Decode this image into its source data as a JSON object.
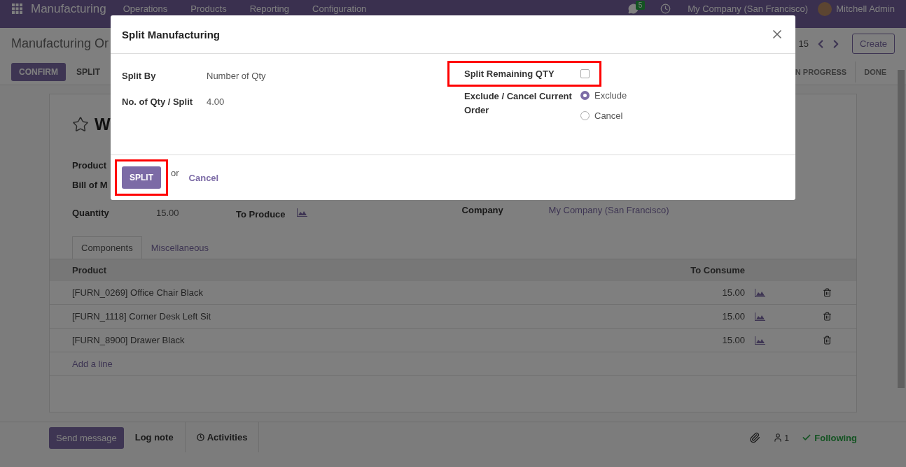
{
  "navbar": {
    "app": "Manufacturing",
    "menus": [
      "Operations",
      "Products",
      "Reporting",
      "Configuration"
    ],
    "messages_count": "5",
    "company": "My Company (San Francisco)",
    "user": "Mitchell Admin"
  },
  "breadcrumb": "Manufacturing Or",
  "pager": "15",
  "create_button": "Create",
  "action_buttons": [
    "CONFIRM",
    "SPLIT"
  ],
  "statusbar": [
    {
      "label": "N PROGRESS",
      "selected": false
    },
    {
      "label": "DONE",
      "selected": false
    }
  ],
  "form": {
    "title": "W",
    "starred": false,
    "product_label": "Product",
    "bom_label": "Bill of M",
    "quantity_label": "Quantity",
    "quantity": "15.00",
    "to_produce_label": "To Produce",
    "company_label": "Company",
    "company": "My Company (San Francisco)"
  },
  "tabs": [
    {
      "label": "Components",
      "selected": true
    },
    {
      "label": "Miscellaneous",
      "selected": false
    }
  ],
  "table": {
    "columns": [
      "Product",
      "To Consume"
    ],
    "rows": [
      {
        "product": "[FURN_0269] Office Chair Black",
        "to_consume": "15.00"
      },
      {
        "product": "[FURN_1118] Corner Desk Left Sit",
        "to_consume": "15.00"
      },
      {
        "product": "[FURN_8900] Drawer Black",
        "to_consume": "15.00"
      }
    ],
    "add_line": "Add a line"
  },
  "chatter": {
    "send_message": "Send message",
    "log_note": "Log note",
    "activities": "Activities",
    "followers": "1",
    "following": "Following"
  },
  "dialog": {
    "title": "Split Manufacturing",
    "fields": [
      {
        "label": "Split By",
        "value": "Number of Qty"
      },
      {
        "label": "No. of Qty / Split",
        "value": "4.00"
      }
    ],
    "split_remaining": {
      "label": "Split Remaining QTY",
      "checked": false,
      "highlighted": true
    },
    "exclude_cancel": {
      "label": "Exclude / Cancel Current Order",
      "options": [
        {
          "label": "Exclude",
          "selected": true
        },
        {
          "label": "Cancel",
          "selected": false
        }
      ]
    },
    "split_button": {
      "label": "SPLIT",
      "highlighted": true
    },
    "or": "or",
    "cancel": "Cancel"
  }
}
